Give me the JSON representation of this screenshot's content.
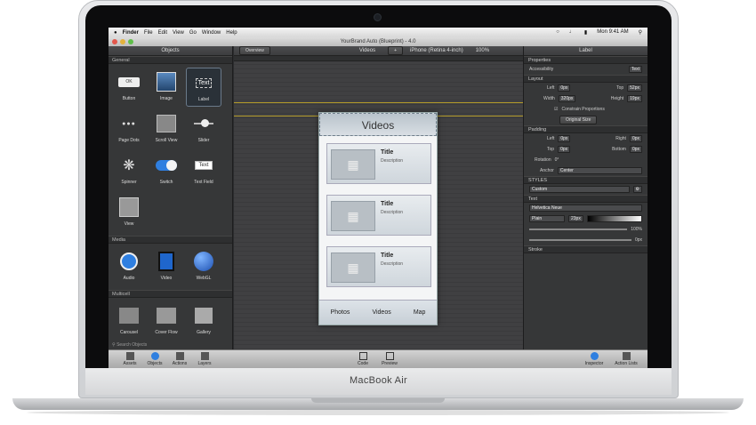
{
  "menubar": {
    "apple": "",
    "app": "Finder",
    "items": [
      "File",
      "Edit",
      "View",
      "Go",
      "Window",
      "Help"
    ],
    "clock": "Mon 9:41 AM"
  },
  "window": {
    "title": "YourBrand Auto (Blueprint) - 4.0"
  },
  "left": {
    "title": "Objects",
    "general": "General",
    "media": "Media",
    "multicell": "Multicell",
    "items_general": [
      "Button",
      "Image",
      "Label",
      "Page Dots",
      "Scroll View",
      "Slider",
      "Spinner",
      "Switch",
      "Text Field",
      "View"
    ],
    "items_media": [
      "Audio",
      "Video",
      "WebGL"
    ],
    "items_multi": [
      "Carousel",
      "Cover Flow",
      "Gallery"
    ],
    "search": "Search Objects",
    "button_text": "OK",
    "label_text": "Text",
    "textfield_text": "Text"
  },
  "center": {
    "overview": "Overview",
    "screen": "Videos",
    "device": "iPhone (Retina 4-inch)",
    "zoom": "100%",
    "phone": {
      "header": "Videos",
      "cells": [
        {
          "title": "Title",
          "desc": "Description"
        },
        {
          "title": "Title",
          "desc": "Description"
        },
        {
          "title": "Title",
          "desc": "Description"
        }
      ],
      "tabs": [
        "Photos",
        "Videos",
        "Map"
      ]
    }
  },
  "right": {
    "title": "Label",
    "properties": "Properties",
    "accessibility": "Accessibility",
    "access_val": "Text",
    "layout": "Layout",
    "left": "Left",
    "left_val": "0px",
    "top": "Top",
    "top_val": "52px",
    "width": "Width",
    "width_val": "320px",
    "height": "Height",
    "height_val": "19px",
    "constrain": "Constrain Proportions",
    "original": "Original Size",
    "padding": "Padding",
    "pl": "Left",
    "pl_val": "0px",
    "pr": "Right",
    "pr_val": "0px",
    "pt": "Top",
    "pt_val": "0px",
    "pb": "Bottom",
    "pb_val": "0px",
    "rotation": "Rotation",
    "rotation_val": "0°",
    "anchor": "Anchor",
    "anchor_val": "Center",
    "styles": "STYLES",
    "style_val": "Custom",
    "text": "Text",
    "font": "Helvetica Neue",
    "weight": "Plain",
    "size": "23px",
    "opacity": "100%",
    "spacing": "0px",
    "stroke": "Stroke"
  },
  "bottombar": {
    "left": [
      "Assets",
      "Objects",
      "Actions",
      "Layers"
    ],
    "center": [
      "Code",
      "Preview"
    ],
    "right": [
      "Inspector",
      "Action Lists"
    ]
  },
  "device_label": "MacBook Air"
}
